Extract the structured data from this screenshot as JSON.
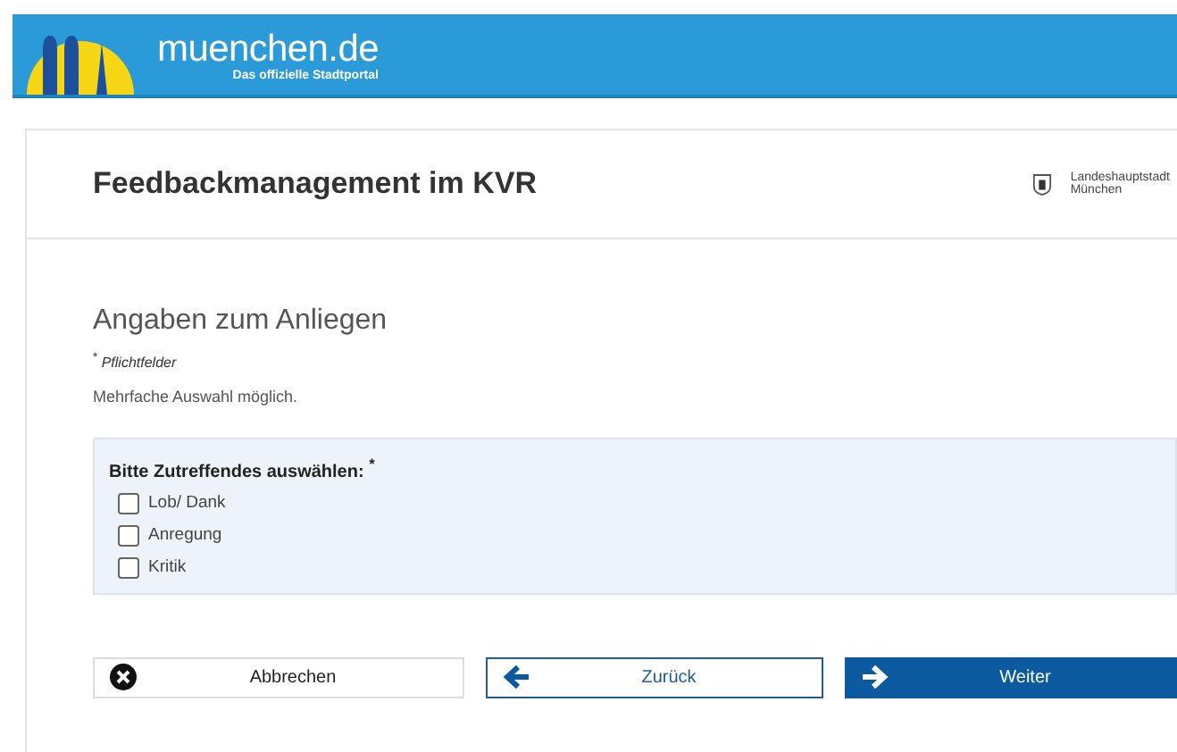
{
  "header": {
    "logo_text": "muenchen.de",
    "tagline": "Das offizielle Stadtportal"
  },
  "page": {
    "title": "Feedbackmanagement im KVR",
    "city_label": [
      "Landeshauptstadt",
      "München"
    ]
  },
  "form": {
    "heading": "Angaben zum Anliegen",
    "required_note": "Pflichtfelder",
    "required_mark": "*",
    "hint": "Mehrfache Auswahl möglich.",
    "group": {
      "legend": "Bitte Zutreffendes auswählen:",
      "required_mark": "*",
      "options": [
        {
          "label": "Lob/ Dank",
          "checked": false
        },
        {
          "label": "Anregung",
          "checked": false
        },
        {
          "label": "Kritik",
          "checked": false
        }
      ]
    }
  },
  "buttons": [
    {
      "label": "Abbrechen",
      "kind": "cancel"
    },
    {
      "label": "Zurück",
      "kind": "back"
    },
    {
      "label": "Weiter",
      "kind": "next"
    }
  ]
}
